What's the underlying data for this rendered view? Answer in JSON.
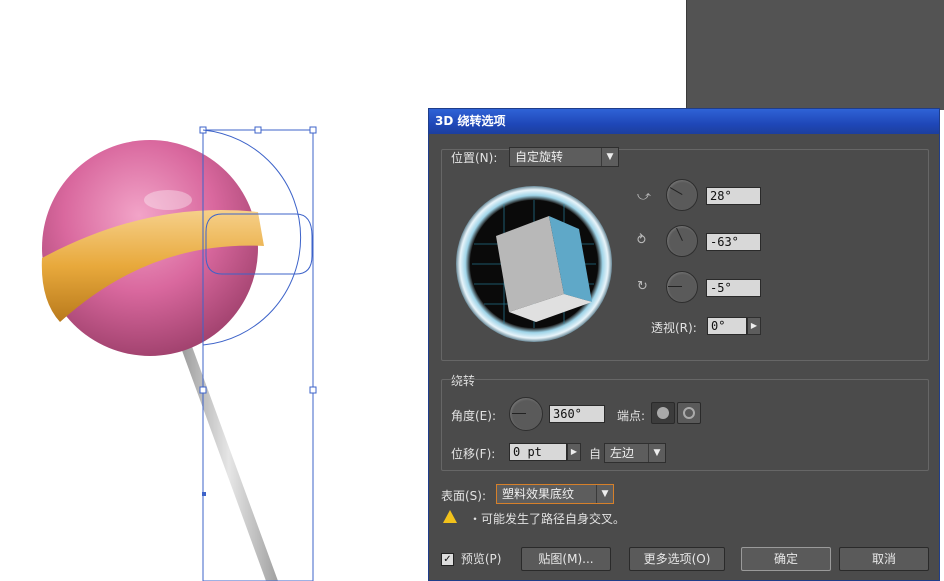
{
  "dialog": {
    "title": "3D 绕转选项",
    "position": {
      "label": "位置(N):",
      "preset": "自定旋转",
      "x_angle": "28°",
      "y_angle": "-63°",
      "z_angle": "-5°",
      "perspective_label": "透视(R):",
      "perspective_value": "0°"
    },
    "revolve": {
      "group_label": "绕转",
      "angle_label": "角度(E):",
      "angle_value": "360°",
      "cap_label": "端点:",
      "offset_label": "位移(F):",
      "offset_value": "0 pt",
      "from_label": "自",
      "from_value": "左边"
    },
    "surface": {
      "label": "表面(S):",
      "value": "塑料效果底纹"
    },
    "warning": "・可能发生了路径自身交叉。",
    "buttons": {
      "preview_label": "预览(P)",
      "map_art": "贴图(M)...",
      "more_options": "更多选项(O)",
      "ok": "确定",
      "cancel": "取消"
    }
  },
  "colors": {
    "candy": "#d9689e",
    "stripe": "#e8a93c",
    "stick": "#c9c9c9",
    "path": "#3d63c9"
  }
}
